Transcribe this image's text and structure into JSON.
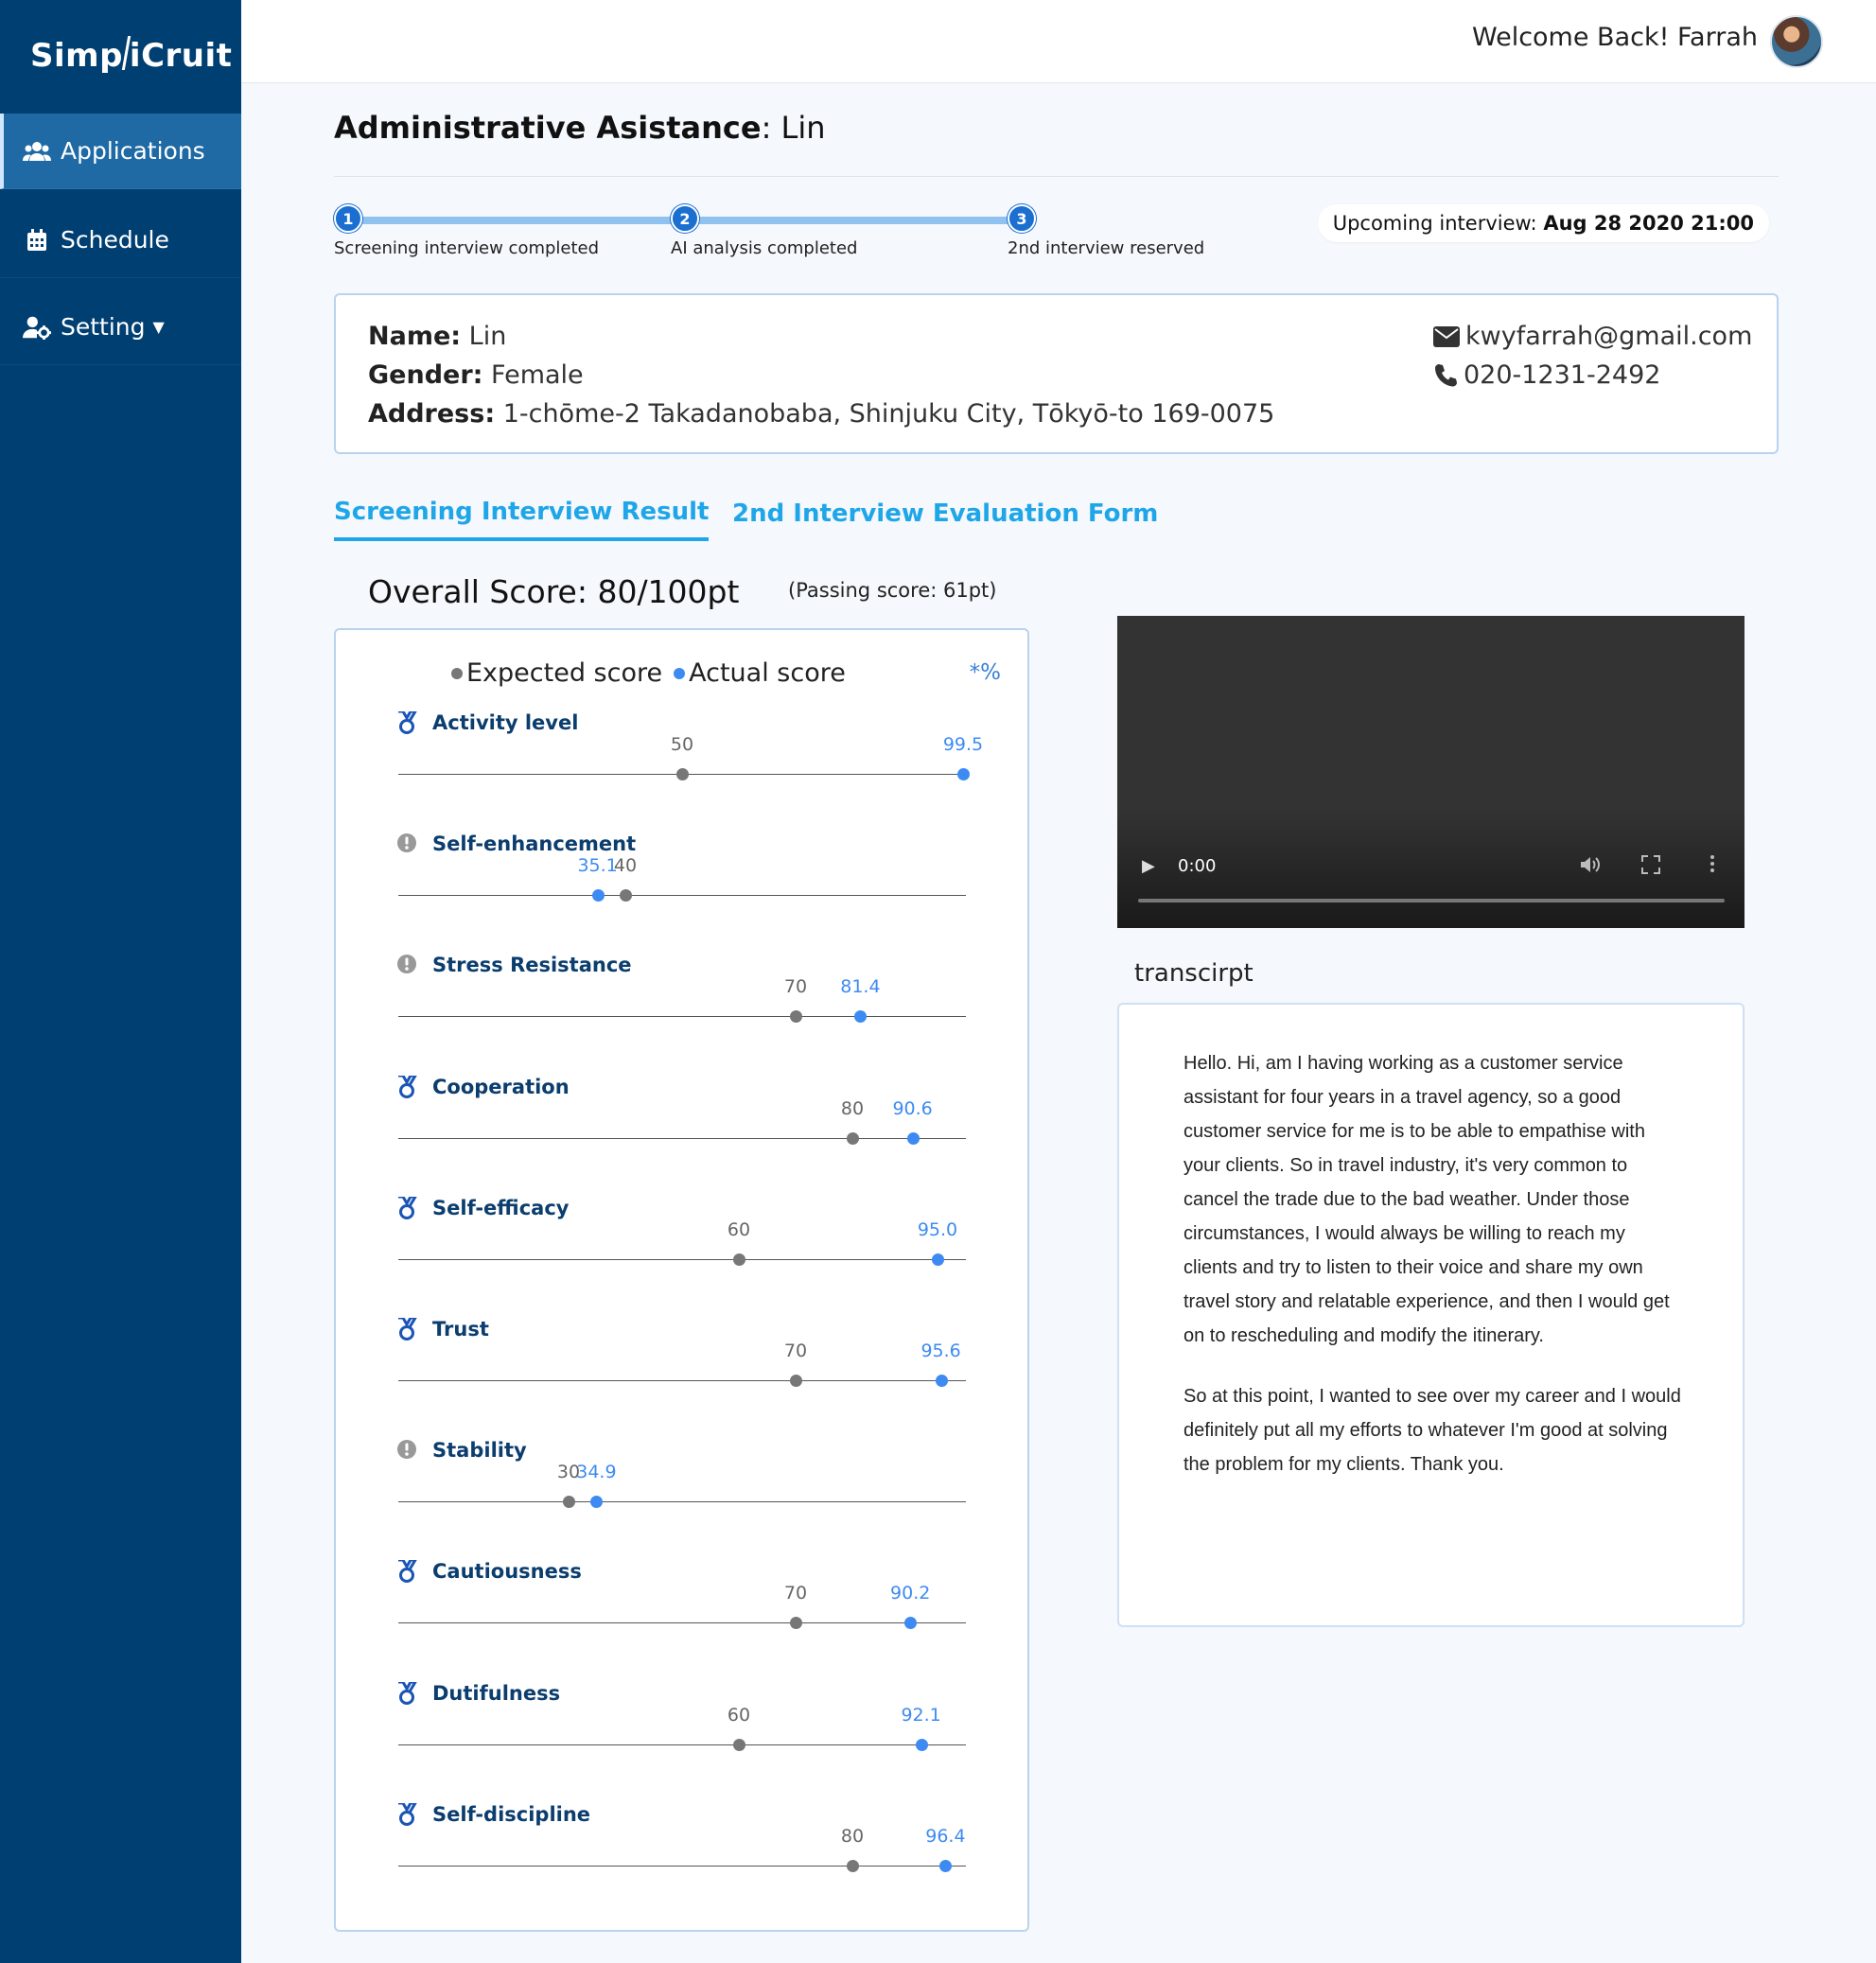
{
  "sidebar": {
    "logo": "SimplCruit",
    "logo_left": "Simp",
    "logo_right": "iCruit",
    "items": [
      {
        "label": "Applications",
        "icon": "users-icon",
        "active": true
      },
      {
        "label": "Schedule",
        "icon": "calendar-icon",
        "active": false
      },
      {
        "label": "Setting",
        "icon": "user-gear-icon",
        "active": false
      }
    ]
  },
  "header": {
    "welcome": "Welcome Back! Farrah"
  },
  "page": {
    "title_bold": "Administrative Asistance",
    "title_rest": ": Lin"
  },
  "steps": [
    {
      "number": "1",
      "label": "Screening interview completed"
    },
    {
      "number": "2",
      "label": "AI analysis completed"
    },
    {
      "number": "3",
      "label": "2nd interview reserved"
    }
  ],
  "upcoming": {
    "label": "Upcoming interview:",
    "value": "Aug 28 2020 21:00"
  },
  "candidate": {
    "name_label": "Name:",
    "name": "Lin",
    "gender_label": "Gender:",
    "gender": "Female",
    "address_label": "Address:",
    "address": "1-chōme-2 Takadanobaba, Shinjuku City, Tōkyō-to 169-0075",
    "email": "kwyfarrah@gmail.com",
    "phone": "020-1231-2492"
  },
  "tabs": [
    {
      "label": "Screening Interview Result",
      "active": true
    },
    {
      "label": "2nd Interview Evaluation Form",
      "active": false
    }
  ],
  "score": {
    "overall": "Overall Score: 80/100pt",
    "passing": "(Passing score: 61pt)",
    "legend_expected": "Expected score",
    "legend_actual": "Actual score",
    "unit": "*%",
    "colors": {
      "expected": "#777777",
      "actual": "#3d8bf2",
      "title": "#0b3d6e"
    }
  },
  "chart_data": {
    "type": "scatter",
    "xlim": [
      0,
      100
    ],
    "series_names": [
      "Expected score",
      "Actual score"
    ],
    "traits": [
      {
        "name": "Activity level",
        "icon": "medal-icon",
        "expected": 50,
        "expected_label": "50",
        "actual": 99.5,
        "actual_label": "99.5"
      },
      {
        "name": "Self-enhancement",
        "icon": "alert-icon",
        "expected": 40,
        "expected_label": "40",
        "actual": 35.1,
        "actual_label": "35.1"
      },
      {
        "name": "Stress Resistance",
        "icon": "alert-icon",
        "expected": 70,
        "expected_label": "70",
        "actual": 81.4,
        "actual_label": "81.4"
      },
      {
        "name": "Cooperation",
        "icon": "medal-icon",
        "expected": 80,
        "expected_label": "80",
        "actual": 90.6,
        "actual_label": "90.6"
      },
      {
        "name": "Self-efficacy",
        "icon": "medal-icon",
        "expected": 60,
        "expected_label": "60",
        "actual": 95.0,
        "actual_label": "95.0"
      },
      {
        "name": "Trust",
        "icon": "medal-icon",
        "expected": 70,
        "expected_label": "70",
        "actual": 95.6,
        "actual_label": "95.6"
      },
      {
        "name": "Stability",
        "icon": "alert-icon",
        "expected": 30,
        "expected_label": "30",
        "actual": 34.9,
        "actual_label": "34.9"
      },
      {
        "name": "Cautiousness",
        "icon": "medal-icon",
        "expected": 70,
        "expected_label": "70",
        "actual": 90.2,
        "actual_label": "90.2"
      },
      {
        "name": "Dutifulness",
        "icon": "medal-icon",
        "expected": 60,
        "expected_label": "60",
        "actual": 92.1,
        "actual_label": "92.1"
      },
      {
        "name": "Self-discipline",
        "icon": "medal-icon",
        "expected": 80,
        "expected_label": "80",
        "actual": 96.4,
        "actual_label": "96.4"
      }
    ]
  },
  "video": {
    "time": "0:00"
  },
  "transcript": {
    "title": "transcirpt",
    "paragraphs": [
      "Hello. Hi, am I having working as a customer service assistant for four years in a travel agency, so a good customer service for me is to be able to empathise with your clients. So in travel industry, it's very common to cancel the trade due to the bad weather. Under those circumstances, I would always be willing to reach my clients and try to listen to their voice and share my own travel story and relatable experience, and then I would get on to rescheduling and modify the itinerary.",
      "So at this point, I wanted to see over my career and I would definitely put all my efforts to whatever I'm good at solving the problem for my clients. Thank you."
    ]
  }
}
